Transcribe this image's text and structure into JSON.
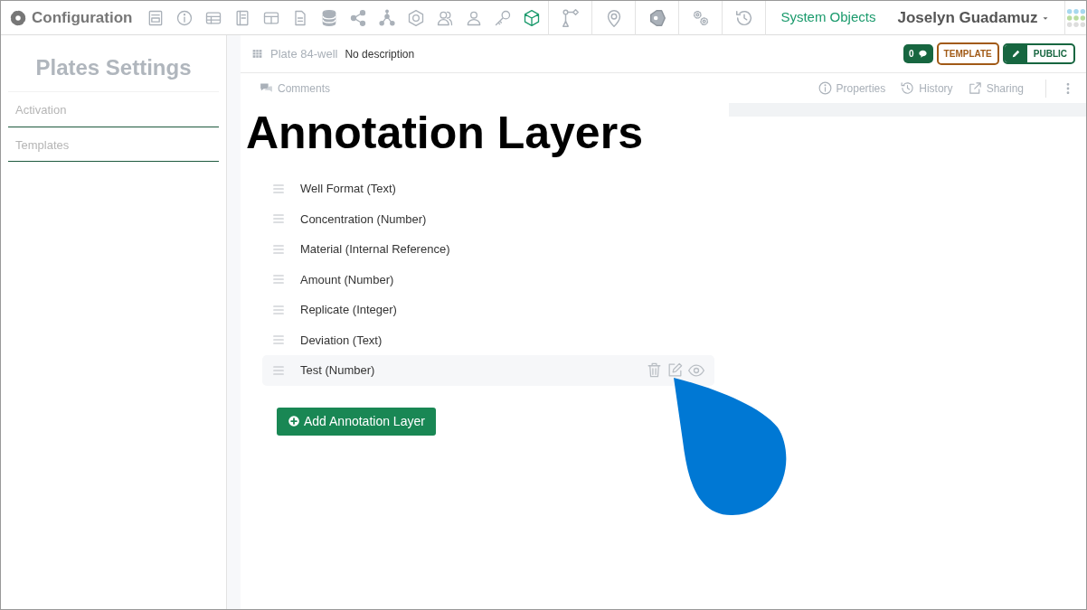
{
  "app_title": "Configuration",
  "system_objects": "System Objects",
  "user": "Joselyn Guadamuz",
  "sidebar": {
    "title": "Plates Settings",
    "items": [
      "Activation",
      "Templates"
    ]
  },
  "record": {
    "title": "Plate 84-well",
    "description": "No description",
    "comment_count": "0",
    "template_badge": "TEMPLATE",
    "public_badge": "PUBLIC"
  },
  "tabs": [
    "Comments",
    "Properties",
    "History",
    "Sharing"
  ],
  "heading": "Annotation Layers",
  "layers": [
    {
      "label": "Well Format (Text)",
      "selected": false
    },
    {
      "label": "Concentration (Number)",
      "selected": false
    },
    {
      "label": "Material (Internal Reference)",
      "selected": false
    },
    {
      "label": "Amount (Number)",
      "selected": false
    },
    {
      "label": "Replicate (Integer)",
      "selected": false
    },
    {
      "label": "Deviation (Text)",
      "selected": false
    },
    {
      "label": "Test (Number)",
      "selected": true
    }
  ],
  "add_button": "Add Annotation Layer"
}
